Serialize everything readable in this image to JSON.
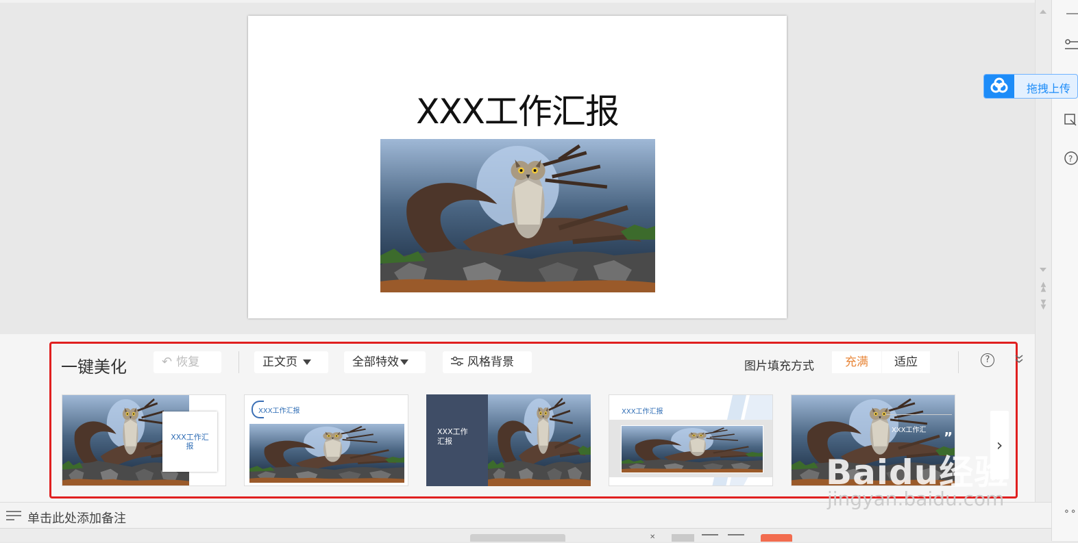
{
  "slide": {
    "title": "XXX工作汇报"
  },
  "upload": {
    "label": "拖拽上传"
  },
  "beautify": {
    "title": "一键美化",
    "restore_label": "恢复",
    "page_type": "正文页",
    "effects": "全部特效",
    "style_bg": "风格背景",
    "fill_mode_label": "图片填充方式",
    "fill_options": [
      "充满",
      "适应"
    ],
    "fill_selected": "充满",
    "templates": [
      {
        "text": "XXX工作汇\n报"
      },
      {
        "text": "XXX工作汇报"
      },
      {
        "text": "XXX工作\n汇报"
      },
      {
        "text": "XXX工作汇报"
      },
      {
        "text": "XXX工作汇"
      }
    ],
    "next_label": "›"
  },
  "notes": {
    "placeholder": "单击此处添加备注"
  },
  "watermark": {
    "main": "Baidu经验",
    "sub": "jingyan.baidu.com"
  },
  "colors": {
    "accent_orange": "#e8873a",
    "frame_red": "#e02020",
    "upload_blue": "#1d8cf8",
    "theme_navy": "#3f4d66"
  }
}
